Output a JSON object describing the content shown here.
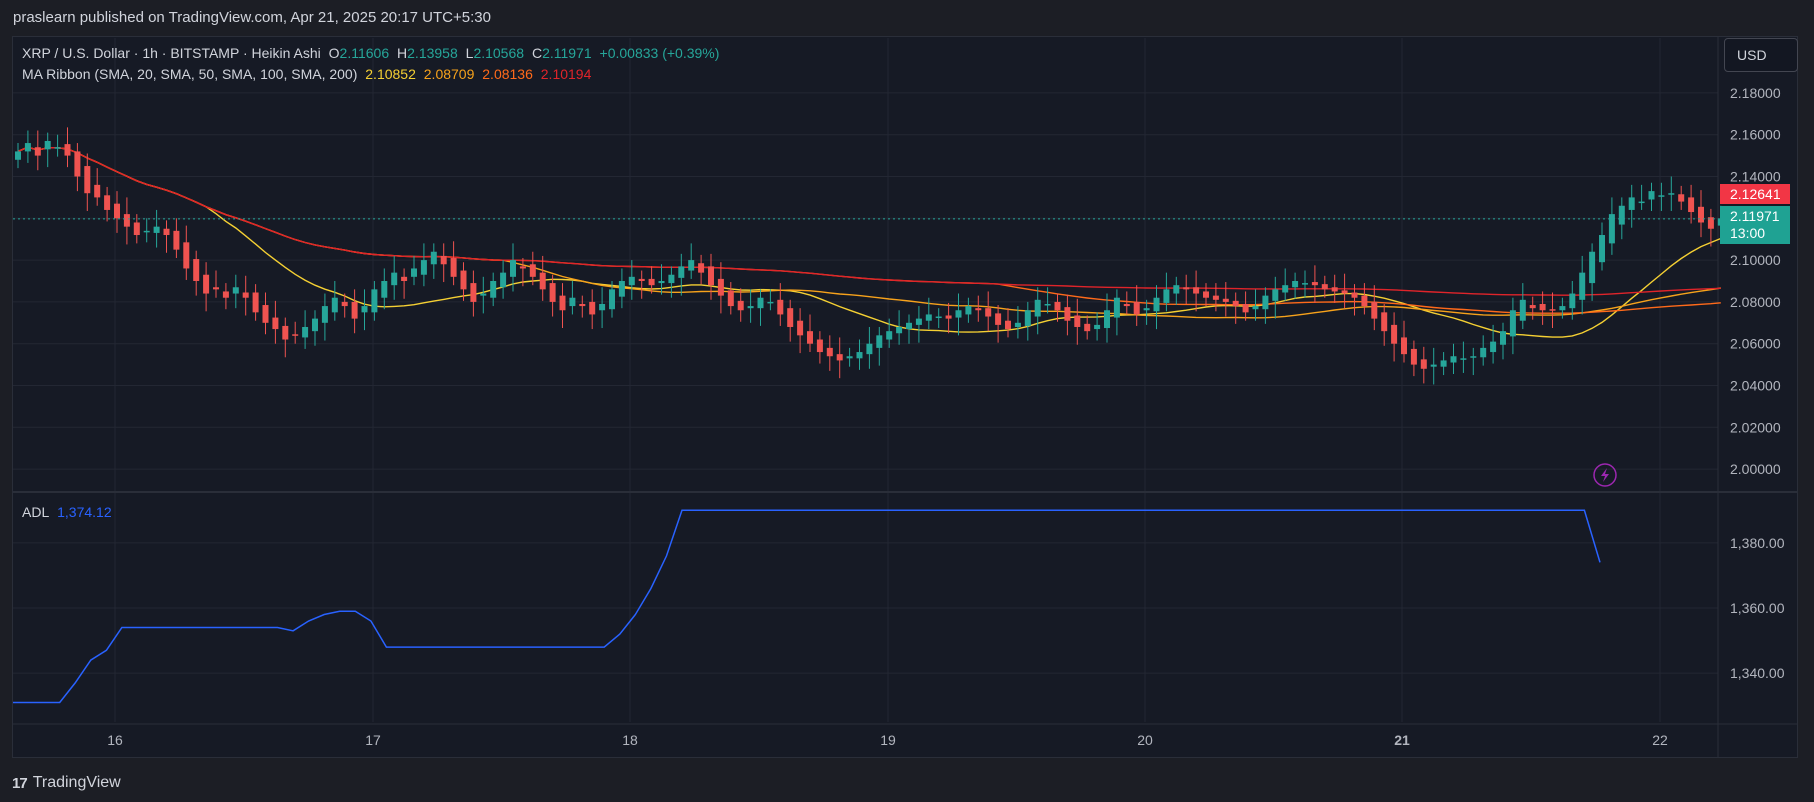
{
  "header": {
    "published": "praslearn published on TradingView.com, Apr 21, 2025 20:17 UTC+5:30"
  },
  "legend": {
    "symbol": "XRP / U.S. Dollar · 1h · BITSTAMP · Heikin Ashi",
    "o_label": "O",
    "o_value": "2.11606",
    "h_label": "H",
    "h_value": "2.13958",
    "l_label": "L",
    "l_value": "2.10568",
    "c_label": "C",
    "c_value": "2.11971",
    "change": "+0.00833 (+0.39%)",
    "ma_title": "MA Ribbon (SMA, 20, SMA, 50, SMA, 100, SMA, 200)",
    "ma_values": [
      "2.10852",
      "2.08709",
      "2.08136",
      "2.10194"
    ],
    "ma_colors": [
      "#f5d033",
      "#f7a21b",
      "#ff6a1a",
      "#e0242a"
    ],
    "adl_title": "ADL",
    "adl_value": "1,374.12"
  },
  "toolbar": {
    "currency_label": "USD"
  },
  "price_tags": {
    "ma200": "2.12641",
    "last_price": "2.11971",
    "countdown": "13:00"
  },
  "footer": {
    "brand": "TradingView",
    "logo": "17"
  },
  "colors": {
    "up": "#26a69a",
    "down": "#ef5350",
    "adl": "#2962ff",
    "background": "#161a25",
    "grid": "#232733"
  },
  "chart_data": [
    {
      "type": "candlestick",
      "title": "XRP / U.S. Dollar · 1h · BITSTAMP · Heikin Ashi",
      "ylim": [
        1.99,
        2.19
      ],
      "y_ticks": [
        "2.00000",
        "2.02000",
        "2.04000",
        "2.06000",
        "2.08000",
        "2.10000",
        "2.12000",
        "2.14000",
        "2.16000",
        "2.18000"
      ],
      "x_ticks": [
        "16",
        "17",
        "18",
        "19",
        "20",
        "21",
        "22"
      ],
      "closes": [
        2.152,
        2.156,
        2.15,
        2.157,
        2.154,
        2.15,
        2.14,
        2.132,
        2.13,
        2.124,
        2.12,
        2.116,
        2.112,
        2.114,
        2.116,
        2.112,
        2.105,
        2.096,
        2.09,
        2.084,
        2.086,
        2.082,
        2.087,
        2.082,
        2.075,
        2.07,
        2.067,
        2.062,
        2.064,
        2.068,
        2.072,
        2.078,
        2.082,
        2.078,
        2.072,
        2.078,
        2.086,
        2.09,
        2.094,
        2.09,
        2.096,
        2.1,
        2.104,
        2.098,
        2.092,
        2.086,
        2.08,
        2.084,
        2.09,
        2.094,
        2.1,
        2.096,
        2.092,
        2.086,
        2.08,
        2.076,
        2.082,
        2.078,
        2.074,
        2.079,
        2.086,
        2.09,
        2.092,
        2.09,
        2.088,
        2.09,
        2.093,
        2.097,
        2.1,
        2.094,
        2.088,
        2.083,
        2.078,
        2.076,
        2.078,
        2.082,
        2.08,
        2.074,
        2.068,
        2.064,
        2.06,
        2.056,
        2.054,
        2.052,
        2.054,
        2.056,
        2.06,
        2.064,
        2.066,
        2.068,
        2.07,
        2.072,
        2.074,
        2.073,
        2.072,
        2.076,
        2.078,
        2.076,
        2.073,
        2.069,
        2.067,
        2.07,
        2.076,
        2.081,
        2.079,
        2.076,
        2.071,
        2.068,
        2.066,
        2.069,
        2.076,
        2.082,
        2.078,
        2.074,
        2.077,
        2.082,
        2.086,
        2.088,
        2.086,
        2.084,
        2.082,
        2.081,
        2.08,
        2.078,
        2.075,
        2.078,
        2.083,
        2.086,
        2.088,
        2.09,
        2.089,
        2.088,
        2.086,
        2.085,
        2.084,
        2.082,
        2.078,
        2.072,
        2.066,
        2.06,
        2.055,
        2.05,
        2.048,
        2.05,
        2.052,
        2.054,
        2.053,
        2.054,
        2.058,
        2.061,
        2.066,
        2.076,
        2.081,
        2.077,
        2.076,
        2.076,
        2.078,
        2.084,
        2.094,
        2.104,
        2.112,
        2.122,
        2.126,
        2.13,
        2.128,
        2.133,
        2.131,
        2.132,
        2.128,
        2.123,
        2.118,
        2.115,
        2.12
      ]
    },
    {
      "type": "line",
      "title": "ADL",
      "ylim": [
        1325,
        1395
      ],
      "y_ticks": [
        "1,340.00",
        "1,360.00",
        "1,380.00"
      ],
      "x_ticks": [
        "16",
        "17",
        "18",
        "19",
        "20",
        "21",
        "22"
      ],
      "series": [
        {
          "name": "ADL",
          "values": [
            1331,
            1331,
            1331,
            1331,
            1337,
            1344,
            1347,
            1354,
            1354,
            1354,
            1354,
            1354,
            1354,
            1354,
            1354,
            1354,
            1354,
            1354,
            1353,
            1356,
            1358,
            1359,
            1359,
            1356,
            1348,
            1348,
            1348,
            1348,
            1348,
            1348,
            1348,
            1348,
            1348,
            1348,
            1348,
            1348,
            1348,
            1348,
            1348,
            1352,
            1358,
            1366,
            1376,
            1390,
            1390,
            1390,
            1390,
            1390,
            1390,
            1390,
            1390,
            1390,
            1390,
            1390,
            1390,
            1390,
            1390,
            1390,
            1390,
            1390,
            1390,
            1390,
            1390,
            1390,
            1390,
            1390,
            1390,
            1390,
            1390,
            1390,
            1390,
            1390,
            1390,
            1390,
            1390,
            1390,
            1390,
            1390,
            1390,
            1390,
            1390,
            1390,
            1390,
            1390,
            1390,
            1390,
            1390,
            1390,
            1390,
            1390,
            1390,
            1390,
            1390,
            1390,
            1390,
            1390,
            1390,
            1390,
            1390,
            1390,
            1390,
            1390,
            1374
          ]
        }
      ]
    }
  ]
}
